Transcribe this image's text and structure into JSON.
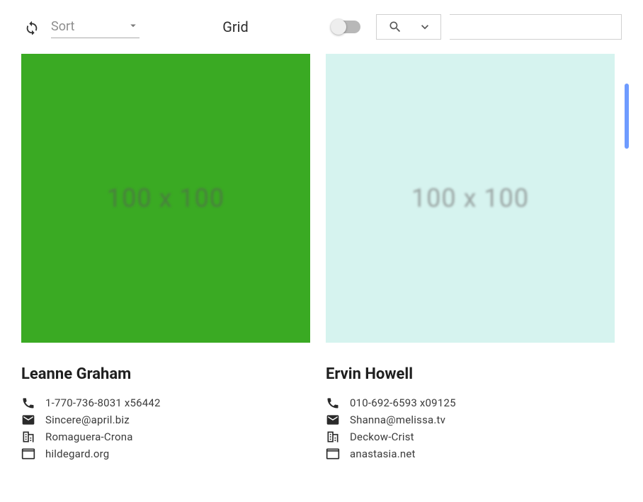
{
  "toolbar": {
    "sort_placeholder": "Sort",
    "grid_label": "Grid",
    "toggle_on": false,
    "search_value": ""
  },
  "placeholder_text": "100 x 100",
  "cards": [
    {
      "color": "green",
      "name": "Leanne Graham",
      "phone": "1-770-736-8031 x56442",
      "email": "Sincere@april.biz",
      "company": "Romaguera-Crona",
      "website": "hildegard.org"
    },
    {
      "color": "mint",
      "name": "Ervin Howell",
      "phone": "010-692-6593 x09125",
      "email": "Shanna@melissa.tv",
      "company": "Deckow-Crist",
      "website": "anastasia.net"
    }
  ]
}
